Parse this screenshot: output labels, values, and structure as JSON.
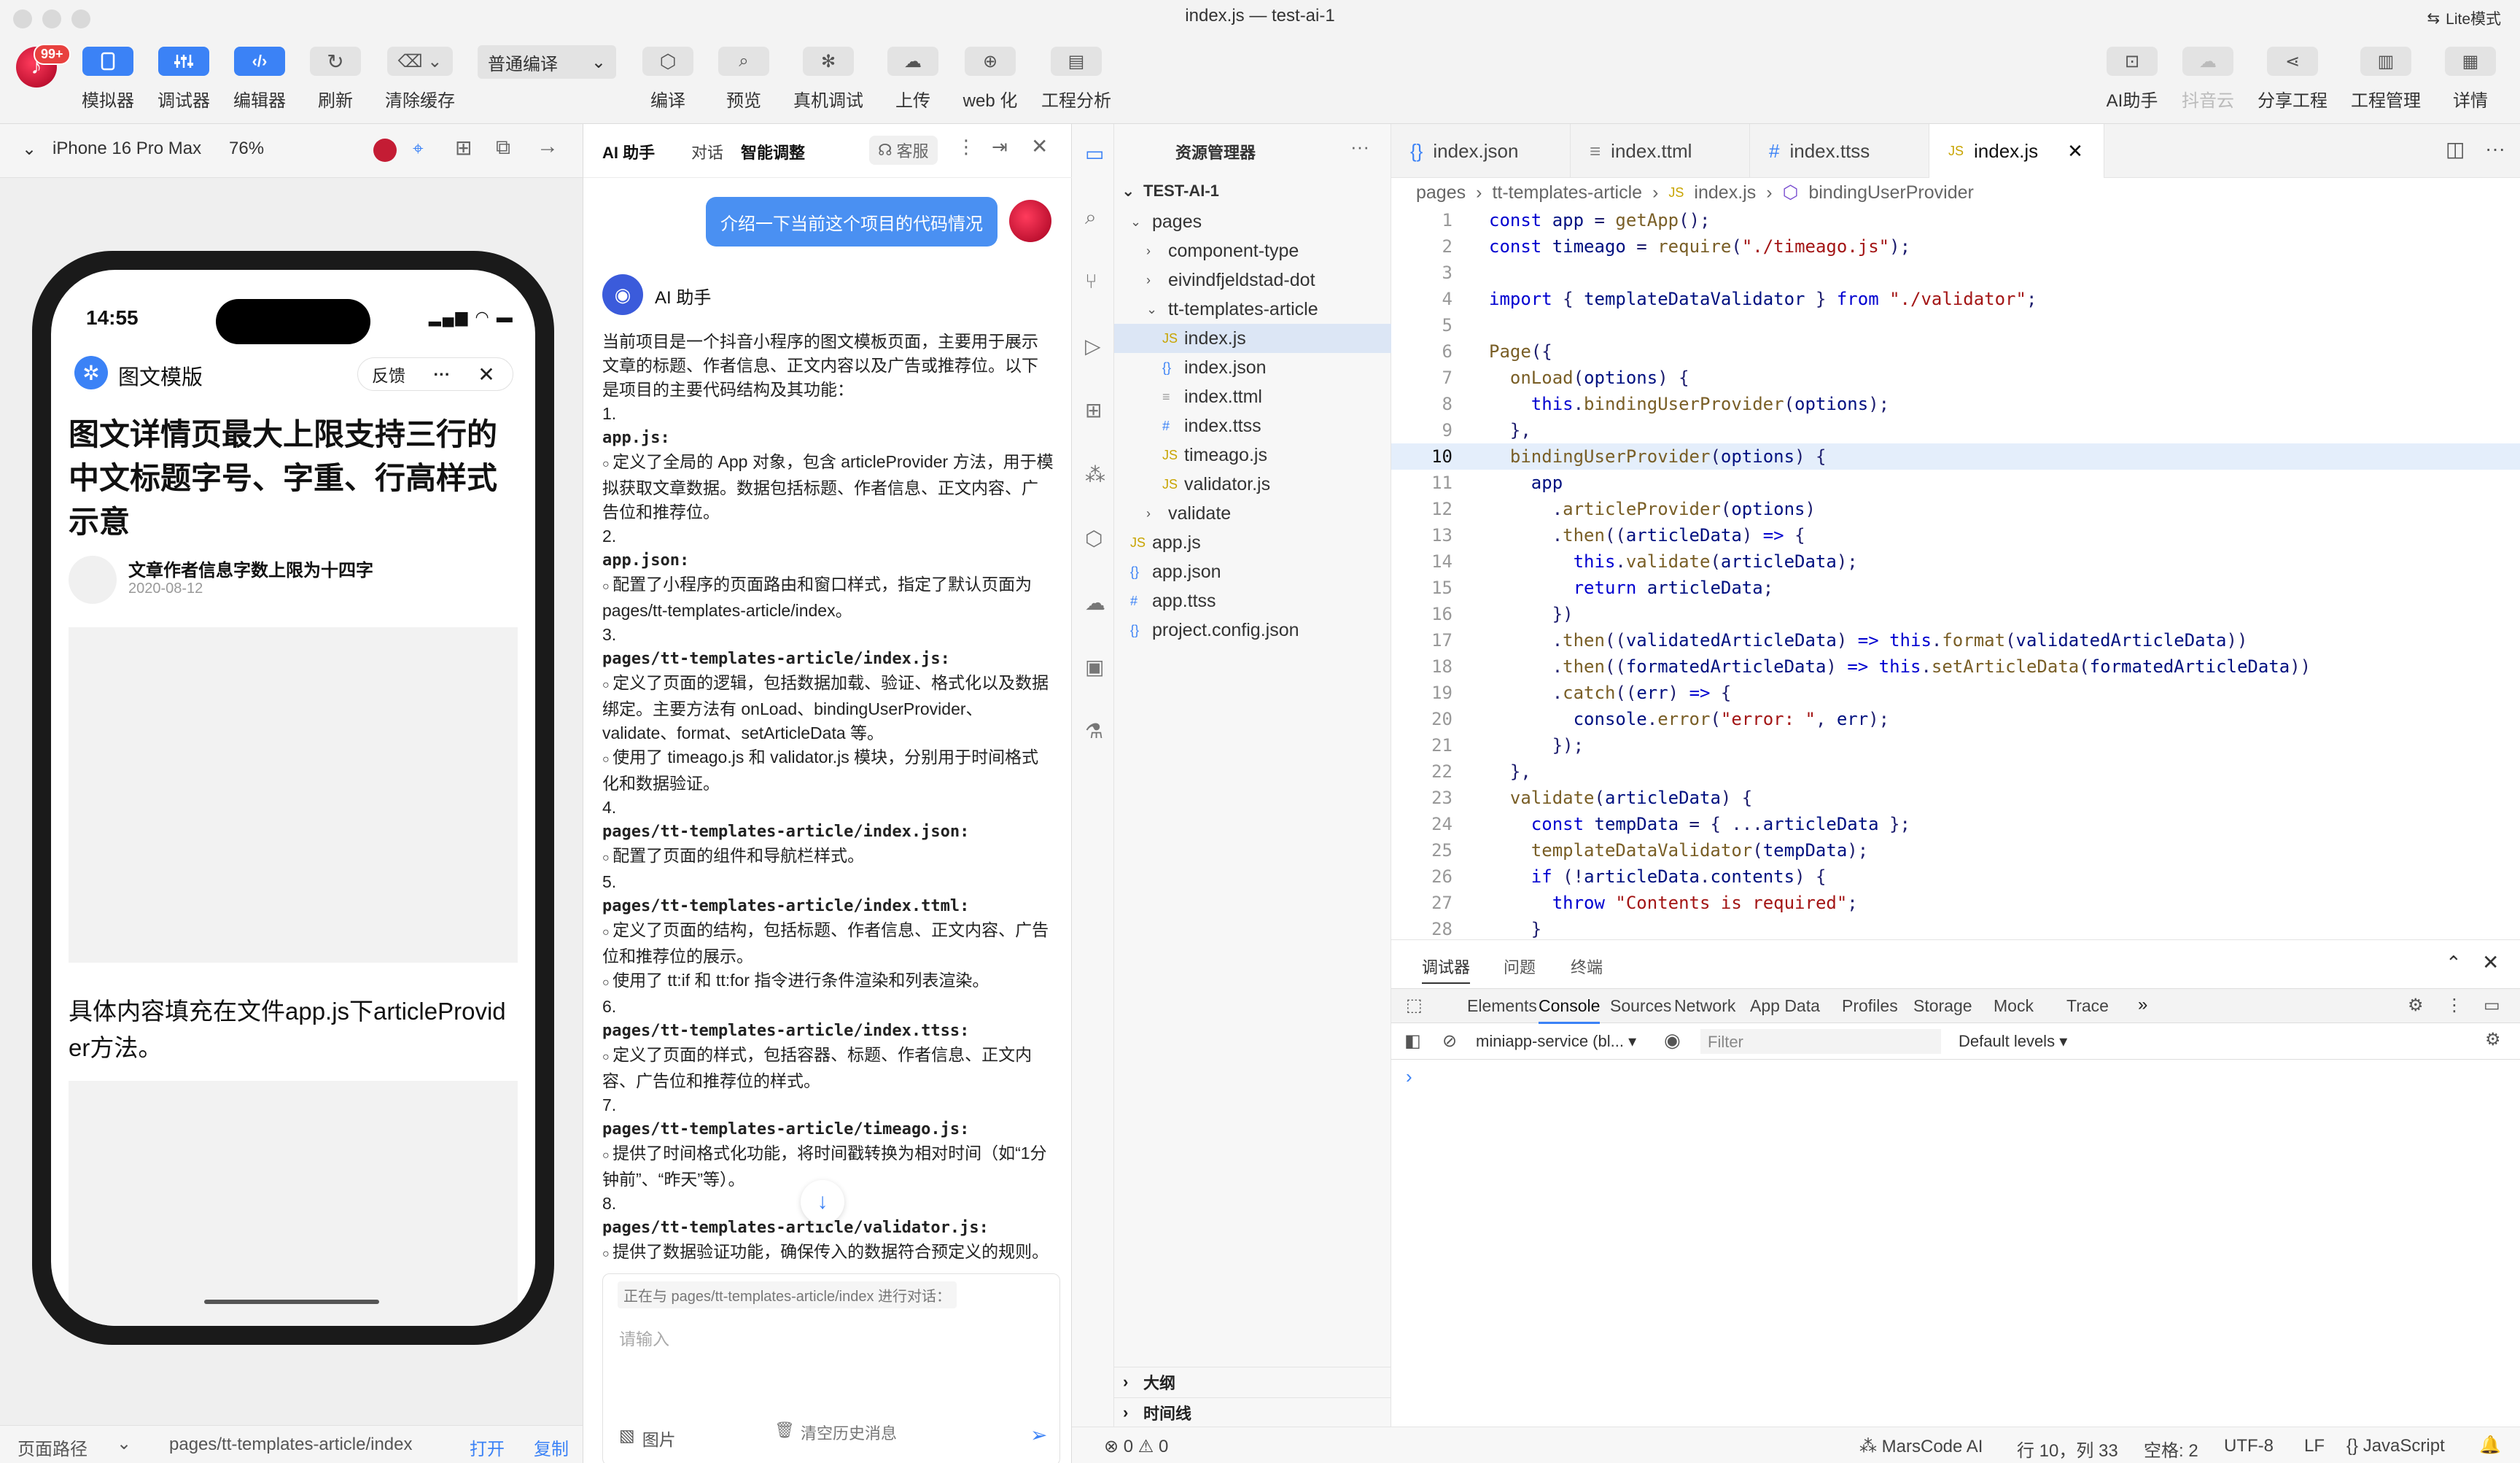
{
  "window": {
    "title": "index.js — test-ai-1",
    "lite_mode": "Lite模式"
  },
  "toolbar": {
    "avatar_badge": "99+",
    "items": [
      {
        "label": "模拟器"
      },
      {
        "label": "调试器"
      },
      {
        "label": "编辑器"
      },
      {
        "label": "刷新"
      },
      {
        "label": "清除缓存"
      },
      {
        "label": "编译"
      },
      {
        "label": "预览"
      },
      {
        "label": "真机调试"
      },
      {
        "label": "上传"
      },
      {
        "label": "web 化"
      },
      {
        "label": "工程分析"
      }
    ],
    "compile_mode": "普通编译",
    "right_items": [
      {
        "label": "AI助手"
      },
      {
        "label": "抖音云"
      },
      {
        "label": "分享工程"
      },
      {
        "label": "工程管理"
      },
      {
        "label": "详情"
      }
    ]
  },
  "simulator": {
    "device": "iPhone 16 Pro Max",
    "zoom": "76%",
    "status_time": "14:55",
    "page_title": "图文模版",
    "feedback": "反馈",
    "article_title": "图文详情页最大上限支持三行的中文标题字号、字重、行高样式示意",
    "author": "文章作者信息字数上限为十四字",
    "date": "2020-08-12",
    "body_text": "具体内容填充在文件app.js下articleProvider方法。",
    "footer_label": "页面路径",
    "footer_path": "pages/tt-templates-article/index",
    "footer_open": "打开",
    "footer_copy": "复制"
  },
  "ai": {
    "tabs": {
      "assistant": "AI 助手",
      "chat": "对话",
      "tuning": "智能调整",
      "service": "客服"
    },
    "user_message": "介绍一下当前这个项目的代码情况",
    "assistant_name": "AI 助手",
    "intro": "当前项目是一个抖音小程序的图文模板页面，主要用于展示文章的标题、作者信息、正文内容以及广告或推荐位。以下是项目的主要代码结构及其功能：",
    "sections": [
      {
        "num": "1.",
        "file": "app.js",
        "bullets": [
          "定义了全局的 App 对象，包含 articleProvider 方法，用于模拟获取文章数据。数据包括标题、作者信息、正文内容、广告位和推荐位。"
        ]
      },
      {
        "num": "2.",
        "file": "app.json",
        "bullets": [
          "配置了小程序的页面路由和窗口样式，指定了默认页面为 pages/tt-templates-article/index。"
        ]
      },
      {
        "num": "3.",
        "file": "pages/tt-templates-article/index.js",
        "bullets": [
          "定义了页面的逻辑，包括数据加载、验证、格式化以及数据绑定。主要方法有 onLoad、bindingUserProvider、validate、format、setArticleData 等。",
          "使用了 timeago.js 和 validator.js 模块，分别用于时间格式化和数据验证。"
        ]
      },
      {
        "num": "4.",
        "file": "pages/tt-templates-article/index.json",
        "bullets": [
          "配置了页面的组件和导航栏样式。"
        ]
      },
      {
        "num": "5.",
        "file": "pages/tt-templates-article/index.ttml",
        "bullets": [
          "定义了页面的结构，包括标题、作者信息、正文内容、广告位和推荐位的展示。",
          "使用了 tt:if 和 tt:for 指令进行条件渲染和列表渲染。"
        ]
      },
      {
        "num": "6.",
        "file": "pages/tt-templates-article/index.ttss",
        "bullets": [
          "定义了页面的样式，包括容器、标题、作者信息、正文内容、广告位和推荐位的样式。"
        ]
      },
      {
        "num": "7.",
        "file": "pages/tt-templates-article/timeago.js",
        "bullets": [
          "提供了时间格式化功能，将时间戳转换为相对时间（如“1分钟前”、“昨天”等）。"
        ]
      },
      {
        "num": "8.",
        "file": "pages/tt-templates-article/validator.js",
        "bullets": [
          "提供了数据验证功能，确保传入的数据符合预定义的规则。"
        ]
      }
    ],
    "context_hint": "正在与 pages/tt-templates-article/index 进行对话：",
    "input_placeholder": "请输入",
    "image_btn": "图片",
    "clear_history": "清空历史消息"
  },
  "explorer": {
    "title": "资源管理器",
    "root": "TEST-AI-1",
    "items": [
      {
        "name": "pages",
        "icon": "chevron-down-icon"
      },
      {
        "name": "component-type",
        "icon": "chevron-right-icon"
      },
      {
        "name": "eivindfjeldstad-dot",
        "icon": "chevron-right-icon"
      },
      {
        "name": "tt-templates-article",
        "icon": "chevron-down-icon"
      },
      {
        "name": "index.js",
        "icon": "js-file-icon"
      },
      {
        "name": "index.json",
        "icon": "json-file-icon"
      },
      {
        "name": "index.ttml",
        "icon": "markup-file-icon"
      },
      {
        "name": "index.ttss",
        "icon": "style-file-icon"
      },
      {
        "name": "timeago.js",
        "icon": "js-file-icon"
      },
      {
        "name": "validator.js",
        "icon": "js-file-icon"
      },
      {
        "name": "validate",
        "icon": "chevron-right-icon"
      },
      {
        "name": "app.js",
        "icon": "js-file-icon"
      },
      {
        "name": "app.json",
        "icon": "json-file-icon"
      },
      {
        "name": "app.ttss",
        "icon": "style-file-icon"
      },
      {
        "name": "project.config.json",
        "icon": "json-file-icon"
      }
    ],
    "outline": "大纲",
    "timeline": "时间线"
  },
  "editor": {
    "tabs": [
      {
        "name": "index.json",
        "icon": "{}"
      },
      {
        "name": "index.ttml",
        "icon": "≡"
      },
      {
        "name": "index.ttss",
        "icon": "#"
      },
      {
        "name": "index.js",
        "icon": "JS"
      }
    ],
    "breadcrumb": [
      "pages",
      "tt-templates-article",
      "index.js",
      "bindingUserProvider"
    ],
    "current_line": 10
  },
  "devtools": {
    "panel_tabs": [
      "调试器",
      "问题",
      "终端"
    ],
    "tabs": [
      "Elements",
      "Console",
      "Sources",
      "Network",
      "App Data",
      "Profiles",
      "Storage",
      "Mock",
      "Trace"
    ],
    "active_tab": "Console",
    "context": "miniapp-service (bl...",
    "filter_placeholder": "Filter",
    "levels": "Default levels",
    "prompt": "›"
  },
  "status": {
    "problems": "0",
    "warnings": "0",
    "marscode": "MarsCode AI",
    "position": "行 10，列 33",
    "spaces": "空格: 2",
    "encoding": "UTF-8",
    "eol": "LF",
    "language": "JavaScript"
  },
  "colors": {
    "accent": "#3b82f6",
    "bubble": "#4a90f2",
    "highlight": "#e4eefb",
    "selection": "#dce6f5"
  }
}
